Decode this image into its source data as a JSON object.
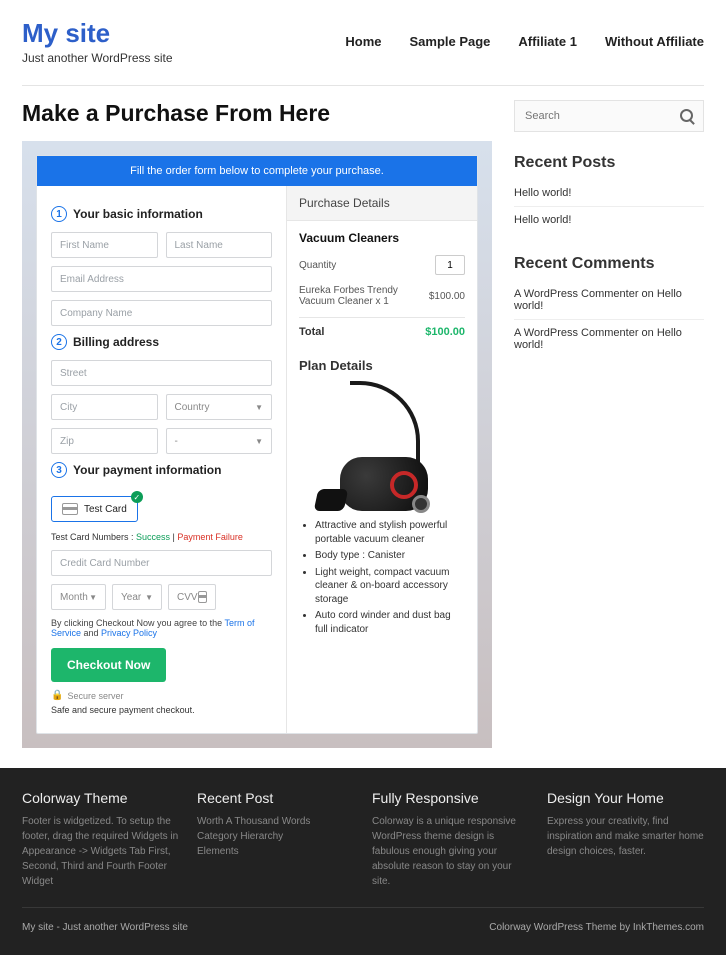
{
  "site": {
    "title": "My site",
    "tagline": "Just another WordPress site"
  },
  "nav": {
    "home": "Home",
    "sample": "Sample Page",
    "aff1": "Affiliate 1",
    "noaff": "Without Affiliate"
  },
  "page": {
    "title": "Make a Purchase From Here"
  },
  "form": {
    "banner": "Fill the order form below to complete your purchase.",
    "step1": "Your basic information",
    "first_name": "First Name",
    "last_name": "Last Name",
    "email": "Email Address",
    "company": "Company Name",
    "step2": "Billing address",
    "street": "Street",
    "city": "City",
    "country": "Country",
    "zip": "Zip",
    "state_dash": "-",
    "step3": "Your payment information",
    "test_card": "Test Card",
    "hint_pre": "Test Card Numbers : ",
    "hint_s": "Success",
    "hint_sep": " | ",
    "hint_f": "Payment Failure",
    "cc": "Credit Card Number",
    "month": "Month",
    "year": "Year",
    "cvv": "CVV",
    "terms_pre": "By clicking Checkout Now you agree to the ",
    "tos": "Term of Service",
    "and": " and ",
    "pp": "Privacy Policy",
    "checkout": "Checkout Now",
    "secure": "Secure server",
    "safe": "Safe and secure payment checkout."
  },
  "purchase": {
    "head": "Purchase Details",
    "group": "Vacuum Cleaners",
    "qty_label": "Quantity",
    "qty_val": "1",
    "line1_label": "Eureka Forbes Trendy Vacuum Cleaner x 1",
    "line1_price": "$100.00",
    "total_label": "Total",
    "total_val": "$100.00"
  },
  "plan": {
    "title": "Plan Details",
    "b1": "Attractive and stylish powerful portable vacuum cleaner",
    "b2": "Body type : Canister",
    "b3": "Light weight, compact vacuum cleaner & on-board accessory storage",
    "b4": "Auto cord winder and dust bag full indicator"
  },
  "sidebar": {
    "search": "Search",
    "recent_h": "Recent Posts",
    "p1": "Hello world!",
    "p2": "Hello world!",
    "comments_h": "Recent Comments",
    "c1": "A WordPress Commenter on Hello world!",
    "c2": "A WordPress Commenter on Hello world!"
  },
  "footer": {
    "c1h": "Colorway Theme",
    "c1t": "Footer is widgetized. To setup the footer, drag the required Widgets in Appearance -> Widgets Tab First, Second, Third and Fourth Footer Widget",
    "c2h": "Recent Post",
    "c2a": "Worth A Thousand Words",
    "c2b": "Category Hierarchy",
    "c2c": "Elements",
    "c3h": "Fully Responsive",
    "c3t": "Colorway is a unique responsive WordPress theme design is fabulous enough giving your absolute reason to stay on your site.",
    "c4h": "Design Your Home",
    "c4t": "Express your creativity, find inspiration and make smarter home design choices, faster.",
    "bl": "My site - Just another WordPress site",
    "br": "Colorway WordPress Theme by InkThemes.com"
  }
}
